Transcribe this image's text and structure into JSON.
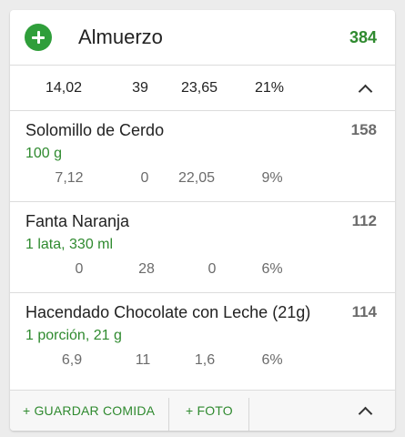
{
  "meal": {
    "title": "Almuerzo",
    "calories": "384",
    "totals": [
      "14,02",
      "39",
      "23,65",
      "21%"
    ]
  },
  "items": [
    {
      "name": "Solomillo de Cerdo",
      "calories": "158",
      "serving": "100 g",
      "values": [
        "7,12",
        "0",
        "22,05",
        "9%"
      ]
    },
    {
      "name": "Fanta Naranja",
      "calories": "112",
      "serving": "1 lata, 330 ml",
      "values": [
        "0",
        "28",
        "0",
        "6%"
      ]
    },
    {
      "name": "Hacendado Chocolate con Leche (21g)",
      "calories": "114",
      "serving": "1 porción, 21 g",
      "values": [
        "6,9",
        "11",
        "1,6",
        "6%"
      ]
    }
  ],
  "footer": {
    "save_meal": "+ GUARDAR COMIDA",
    "photo": "+ FOTO"
  },
  "colors": {
    "accent_green": "#2f9e3a",
    "calorie_green": "#2f8a2f",
    "muted_text": "#6b6b6b"
  },
  "icons": {
    "add": "add-circle-icon",
    "collapse": "chevron-up-icon"
  }
}
